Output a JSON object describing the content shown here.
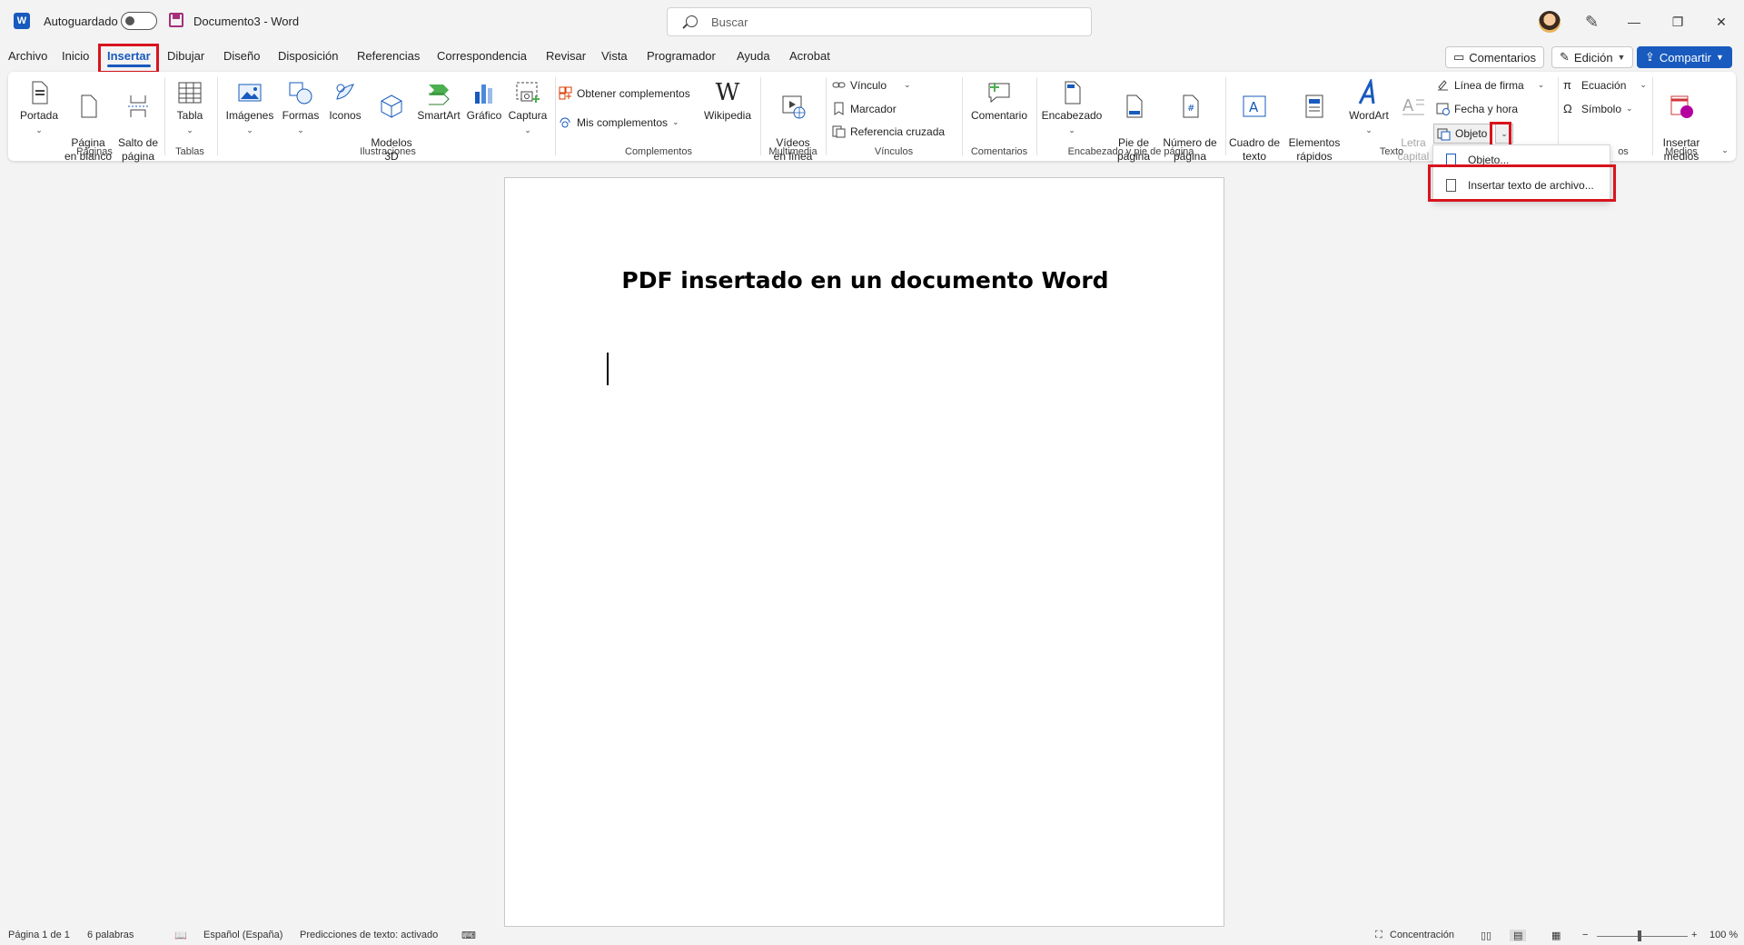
{
  "titlebar": {
    "autosave_label": "Autoguardado",
    "doc_title": "Documento3  -  Word",
    "search_placeholder": "Buscar",
    "logo_letter": "W"
  },
  "tabs": [
    "Archivo",
    "Inicio",
    "Insertar",
    "Dibujar",
    "Diseño",
    "Disposición",
    "Referencias",
    "Correspondencia",
    "Revisar",
    "Vista",
    "Programador",
    "Ayuda",
    "Acrobat"
  ],
  "active_tab": "Insertar",
  "commands": {
    "comments": "Comentarios",
    "editing": "Edición",
    "share": "Compartir"
  },
  "ribbon": {
    "paginas": {
      "label": "Páginas",
      "portada": "Portada",
      "pagina_blanco": "Página\nen blanco",
      "salto": "Salto de\npágina"
    },
    "tablas": {
      "label": "Tablas",
      "tabla": "Tabla"
    },
    "ilustraciones": {
      "label": "Ilustraciones",
      "imagenes": "Imágenes",
      "formas": "Formas",
      "iconos": "Iconos",
      "modelos": "Modelos\n3D",
      "smartart": "SmartArt",
      "grafico": "Gráfico",
      "captura": "Captura"
    },
    "complementos": {
      "label": "Complementos",
      "obtener": "Obtener complementos",
      "mis": "Mis complementos",
      "wikipedia": "Wikipedia"
    },
    "multimedia": {
      "label": "Multimedia",
      "videos": "Vídeos\nen línea"
    },
    "vinculos": {
      "label": "Vínculos",
      "vinculo": "Vínculo",
      "marcador": "Marcador",
      "referencia": "Referencia cruzada"
    },
    "comentarios": {
      "label": "Comentarios",
      "comentario": "Comentario"
    },
    "encabezado": {
      "label": "Encabezado y pie de página",
      "encabezado": "Encabezado",
      "pie": "Pie de\npágina",
      "numero": "Número de\npágina"
    },
    "texto": {
      "label": "Texto",
      "cuadro": "Cuadro de\ntexto",
      "elementos": "Elementos\nrápidos",
      "wordart": "WordArt",
      "letra": "Letra\ncapital",
      "linea_firma": "Línea de firma",
      "fecha": "Fecha y hora",
      "objeto": "Objeto"
    },
    "simbolos": {
      "label_fragment": "os",
      "ecuacion": "Ecuación",
      "simbolo": "Símbolo"
    },
    "medios": {
      "label": "Medios",
      "insertar": "Insertar\nmedios"
    }
  },
  "menu": {
    "items": [
      "Objeto...",
      "Insertar texto de archivo..."
    ]
  },
  "document": {
    "heading": "PDF insertado en un documento Word"
  },
  "statusbar": {
    "page": "Página 1 de 1",
    "words": "6 palabras",
    "language": "Español (España)",
    "predictions": "Predicciones de texto: activado",
    "focus": "Concentración",
    "zoom": "100 %"
  },
  "colors": {
    "accent": "#185abd",
    "highlight": "#d8141e"
  }
}
